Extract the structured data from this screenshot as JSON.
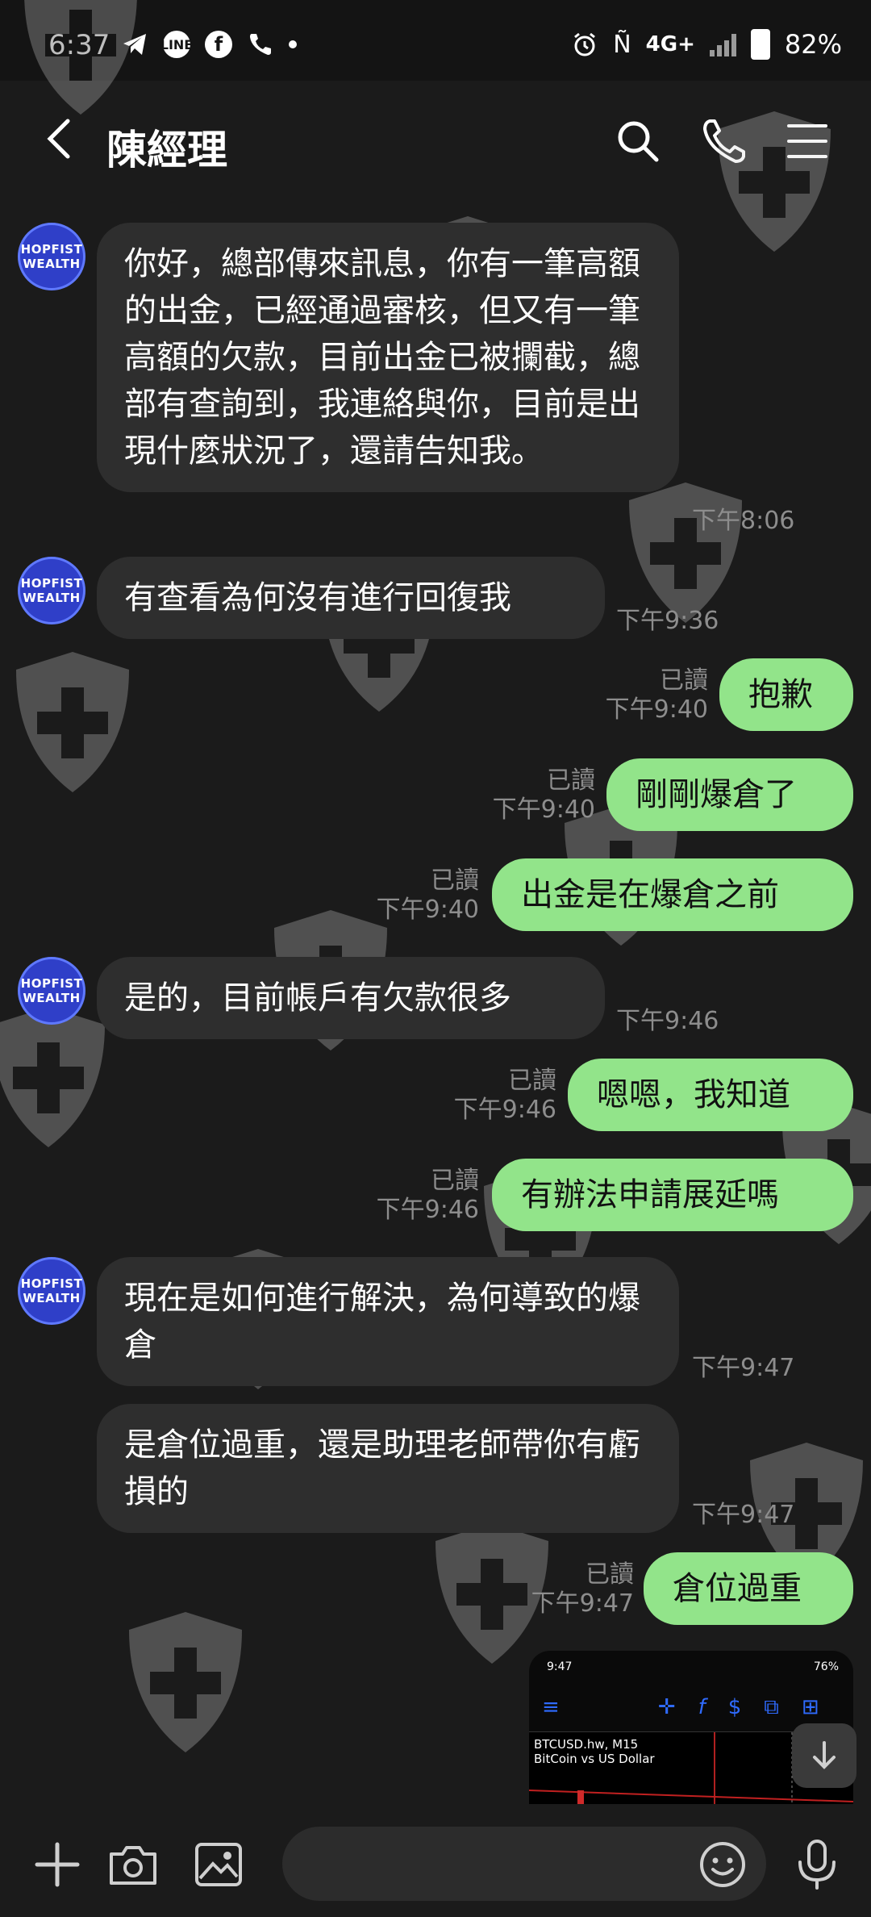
{
  "status_bar": {
    "time": "6:37",
    "network": "4G+",
    "battery": "82%"
  },
  "header": {
    "title": "陳經理"
  },
  "contact": {
    "avatar_text": "HOPFIST WEALTH"
  },
  "messages": [
    {
      "side": "in",
      "text": "你好，總部傳來訊息，你有一筆高額的出金，已經通過審核，但又有一筆高額的欠款，目前出金已被攔截，總部有查詢到，我連絡與你，目前是出現什麼狀況了，還請告知我。",
      "time": "下午8:06"
    },
    {
      "side": "in",
      "text": "有查看為何沒有進行回復我",
      "time": "下午9:36"
    },
    {
      "side": "out",
      "text": "抱歉",
      "read": "已讀",
      "time": "下午9:40"
    },
    {
      "side": "out",
      "text": "剛剛爆倉了",
      "read": "已讀",
      "time": "下午9:40"
    },
    {
      "side": "out",
      "text": "出金是在爆倉之前",
      "read": "已讀",
      "time": "下午9:40"
    },
    {
      "side": "in",
      "text": "是的，目前帳戶有欠款很多",
      "time": "下午9:46"
    },
    {
      "side": "out",
      "text": "嗯嗯，我知道",
      "read": "已讀",
      "time": "下午9:46"
    },
    {
      "side": "out",
      "text": "有辦法申請展延嗎",
      "read": "已讀",
      "time": "下午9:46"
    },
    {
      "side": "in",
      "text": "現在是如何進行解決，為何導致的爆倉",
      "time": "下午9:47"
    },
    {
      "side": "in",
      "text": "是倉位過重，還是助理老師帶你有虧損的",
      "time": "下午9:47"
    },
    {
      "side": "out",
      "text": "倉位過重",
      "read": "已讀",
      "time": "下午9:47"
    }
  ],
  "thumbnail": {
    "status_time": "9:47",
    "battery": "76%",
    "chart_title": "BTCUSD.hw, M15",
    "chart_subtitle": "BitCoin vs US Dollar"
  },
  "colors": {
    "background": "#1b1b1b",
    "incoming_bubble": "#2e2e2e",
    "outgoing_bubble": "#92e48a",
    "meta_text": "#8d8d8d"
  }
}
